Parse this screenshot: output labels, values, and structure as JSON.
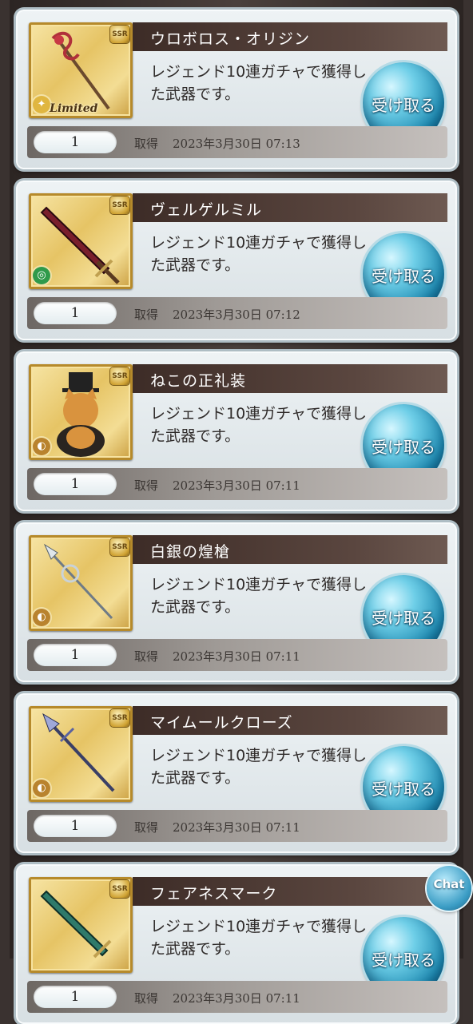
{
  "items": [
    {
      "name": "ウロボロス・オリジン",
      "desc": "レジェンド10連ガチャで獲得した武器です。",
      "button": "受け取る",
      "qty": "1",
      "acquired_label": "取得",
      "date": "2023年3月30日 07:13",
      "rarity": "SSR",
      "limited": "Limited",
      "element_color": "#e0b640"
    },
    {
      "name": "ヴェルゲルミル",
      "desc": "レジェンド10連ガチャで獲得した武器です。",
      "button": "受け取る",
      "qty": "1",
      "acquired_label": "取得",
      "date": "2023年3月30日 07:12",
      "rarity": "SSR",
      "element_color": "#2f9a4a"
    },
    {
      "name": "ねこの正礼装",
      "desc": "レジェンド10連ガチャで獲得した武器です。",
      "button": "受け取る",
      "qty": "1",
      "acquired_label": "取得",
      "date": "2023年3月30日 07:11",
      "rarity": "SSR",
      "element_color": "#b9832e"
    },
    {
      "name": "白銀の煌槍",
      "desc": "レジェンド10連ガチャで獲得した武器です。",
      "button": "受け取る",
      "qty": "1",
      "acquired_label": "取得",
      "date": "2023年3月30日 07:11",
      "rarity": "SSR",
      "element_color": "#b9832e"
    },
    {
      "name": "マイムールクローズ",
      "desc": "レジェンド10連ガチャで獲得した武器です。",
      "button": "受け取る",
      "qty": "1",
      "acquired_label": "取得",
      "date": "2023年3月30日 07:11",
      "rarity": "SSR",
      "element_color": "#b9832e"
    },
    {
      "name": "フェアネスマーク",
      "desc": "レジェンド10連ガチャで獲得した武器です。",
      "button": "受け取る",
      "qty": "1",
      "acquired_label": "取得",
      "date": "2023年3月30日 07:11",
      "rarity": "SSR",
      "element_color": "#2f9a4a"
    }
  ],
  "chat": {
    "label": "Chat"
  }
}
